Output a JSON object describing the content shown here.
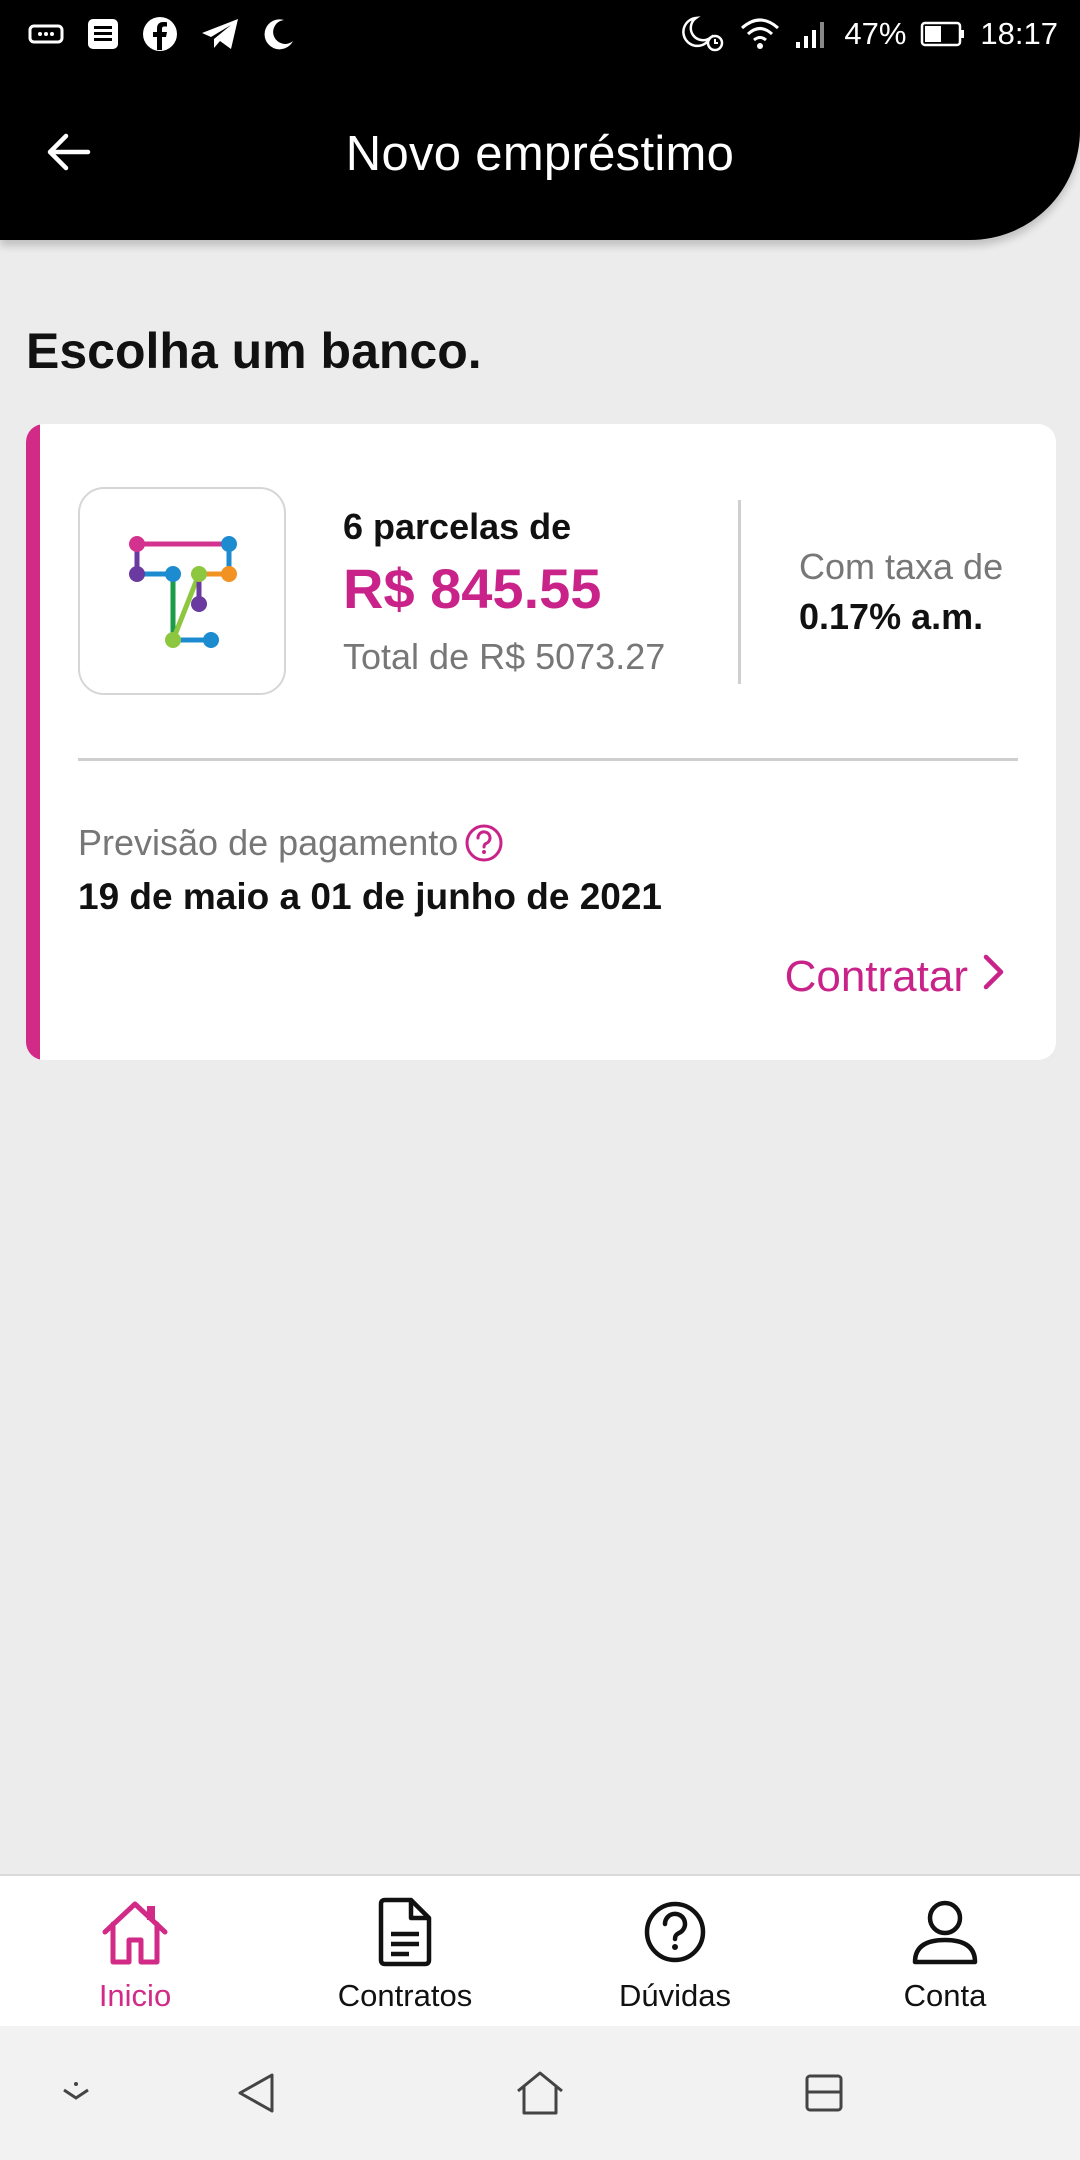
{
  "status_bar": {
    "battery": "47%",
    "time": "18:17",
    "left_icons": [
      "vpn-key-icon",
      "news-icon",
      "facebook-icon",
      "telegram-icon",
      "moon-icon"
    ],
    "right_icons": [
      "do-not-disturb-alarm-icon",
      "wifi-icon",
      "signal-icon",
      "battery-icon"
    ]
  },
  "header": {
    "title": "Novo empréstimo",
    "back_icon": "arrow-left-icon"
  },
  "page": {
    "section_title": "Escolha um banco."
  },
  "offer": {
    "installments_label": "6 parcelas de",
    "installment_value": "R$ 845.55",
    "total": "Total de R$ 5073.27",
    "rate_label": "Com taxa de",
    "rate_value": "0.17% a.m.",
    "forecast_label": "Previsão de pagamento",
    "forecast_value": "19 de maio a 01 de junho de 2021",
    "contract_label": "Contratar",
    "accent_color": "#d22a87"
  },
  "bottom_nav": {
    "items": [
      {
        "label": "Inicio",
        "icon": "home-icon",
        "active": true
      },
      {
        "label": "Contratos",
        "icon": "document-icon",
        "active": false
      },
      {
        "label": "Dúvidas",
        "icon": "help-circle-icon",
        "active": false
      },
      {
        "label": "Conta",
        "icon": "user-icon",
        "active": false
      }
    ]
  },
  "system_nav": {
    "icons": [
      "keyboard-hide-icon",
      "back-triangle-icon",
      "home-outline-icon",
      "recents-icon"
    ]
  }
}
